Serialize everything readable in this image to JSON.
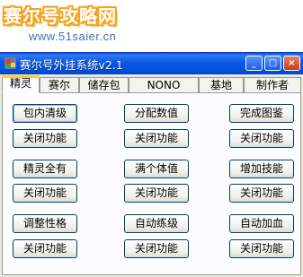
{
  "watermark": {
    "logo": "赛尔号攻略网",
    "url": "www.51saier.cn"
  },
  "window": {
    "title": "赛尔号外挂系统v2.1",
    "minimize_label": "_",
    "maximize_label": "□",
    "close_label": "×"
  },
  "tabs": [
    {
      "label": "精灵"
    },
    {
      "label": "赛尔"
    },
    {
      "label": "储存包"
    },
    {
      "label": "NONO"
    },
    {
      "label": "基地"
    },
    {
      "label": "制作者"
    }
  ],
  "features": [
    {
      "action": "包内清级",
      "close": "关闭功能"
    },
    {
      "action": "分配数值",
      "close": "关闭功能"
    },
    {
      "action": "完成图鉴",
      "close": "关闭功能"
    },
    {
      "action": "精灵全有",
      "close": "关闭功能"
    },
    {
      "action": "满个体值",
      "close": "关闭功能"
    },
    {
      "action": "增加技能",
      "close": "关闭功能"
    },
    {
      "action": "调整性格",
      "close": "关闭功能"
    },
    {
      "action": "自动练级",
      "close": "关闭功能"
    },
    {
      "action": "自动加血",
      "close": "关闭功能"
    }
  ],
  "colors": {
    "titlebar": "#0858e6",
    "window_bg": "#ece9d8",
    "logo_outline": "#f7a21c",
    "url_text": "#3f6fb8"
  }
}
